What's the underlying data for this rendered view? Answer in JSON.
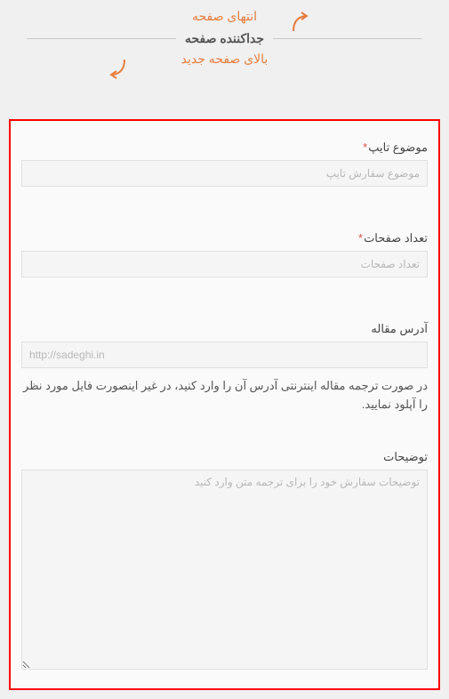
{
  "top": {
    "end_page": "انتهای صفحه",
    "separator": "جداکننده صفحه",
    "new_page": "بالای صفحه جدید"
  },
  "form": {
    "subject": {
      "label": "موضوع تایپ",
      "placeholder": "موضوع سفارش تایپ"
    },
    "pages": {
      "label": "تعداد صفحات",
      "placeholder": "تعداد صفحات"
    },
    "url": {
      "label": "آدرس مقاله",
      "placeholder": "http://sadeghi.in",
      "help": "در صورت ترجمه مقاله اینترنتی آدرس آن را وارد کنید، در غیر اینصورت فایل مورد نظر را آپلود نمایید."
    },
    "description": {
      "label": "توضیحات",
      "placeholder": "توضیحات سفارش خود را برای ترجمه متن وارد کنید"
    }
  }
}
